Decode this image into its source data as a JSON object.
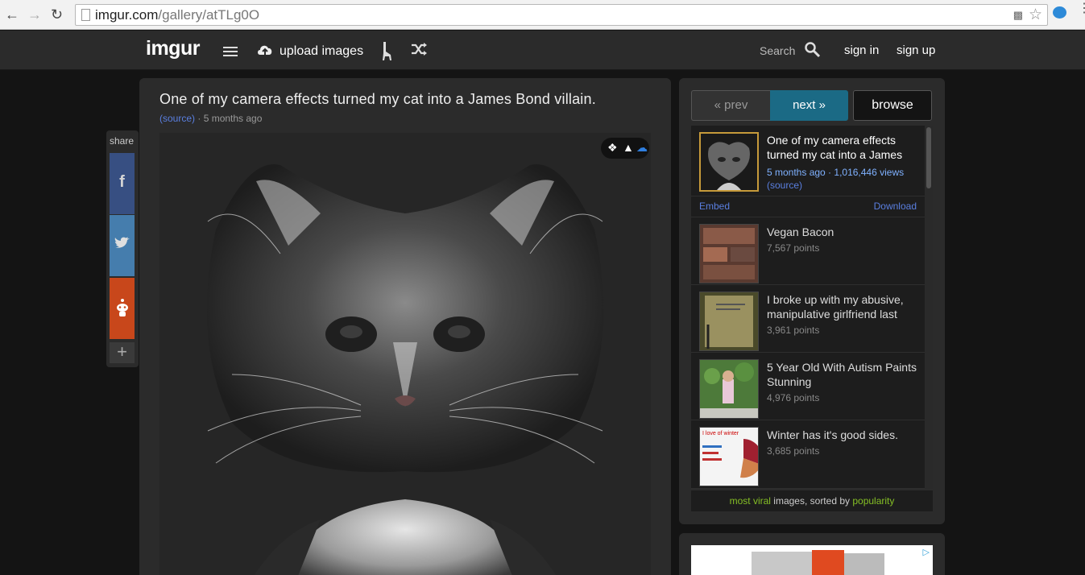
{
  "browser": {
    "url_host": "imgur.com",
    "url_path": "/gallery/atTLg0O"
  },
  "header": {
    "logo": "imgur",
    "upload_label": "upload images",
    "search_label": "Search",
    "signin_label": "sign in",
    "signup_label": "sign up"
  },
  "post": {
    "title": "One of my camera effects turned my cat into a James Bond villain.",
    "source_label": "(source)",
    "separator": " · ",
    "age": "5 months ago"
  },
  "share": {
    "label": "share",
    "facebook_glyph": "f",
    "more_glyph": "+"
  },
  "sidebar": {
    "prev_label": "« prev",
    "next_label": "next »",
    "browse_label": "browse",
    "active": {
      "title": "One of my camera effects turned my cat into a James",
      "age": "5 months ago",
      "separator": " · ",
      "views": "1,016,446 views",
      "source_label": "(source)",
      "embed_label": "Embed",
      "download_label": "Download"
    },
    "items": [
      {
        "title": "Vegan Bacon",
        "points": "7,567 points"
      },
      {
        "title": "I broke up with my abusive, manipulative girlfriend last",
        "points": "3,961 points"
      },
      {
        "title": "5 Year Old With Autism Paints Stunning",
        "points": "4,976 points"
      },
      {
        "title": "Winter has it's good sides.",
        "points": "3,685 points"
      }
    ],
    "footer": {
      "part1": "most viral",
      "part2": " images, sorted by ",
      "part3": "popularity"
    },
    "thumb4_text": "I love of winter"
  },
  "colors": {
    "accent_next": "#1b6a85",
    "link_blue": "#5a7fe0",
    "viral_green": "#85bf25"
  }
}
